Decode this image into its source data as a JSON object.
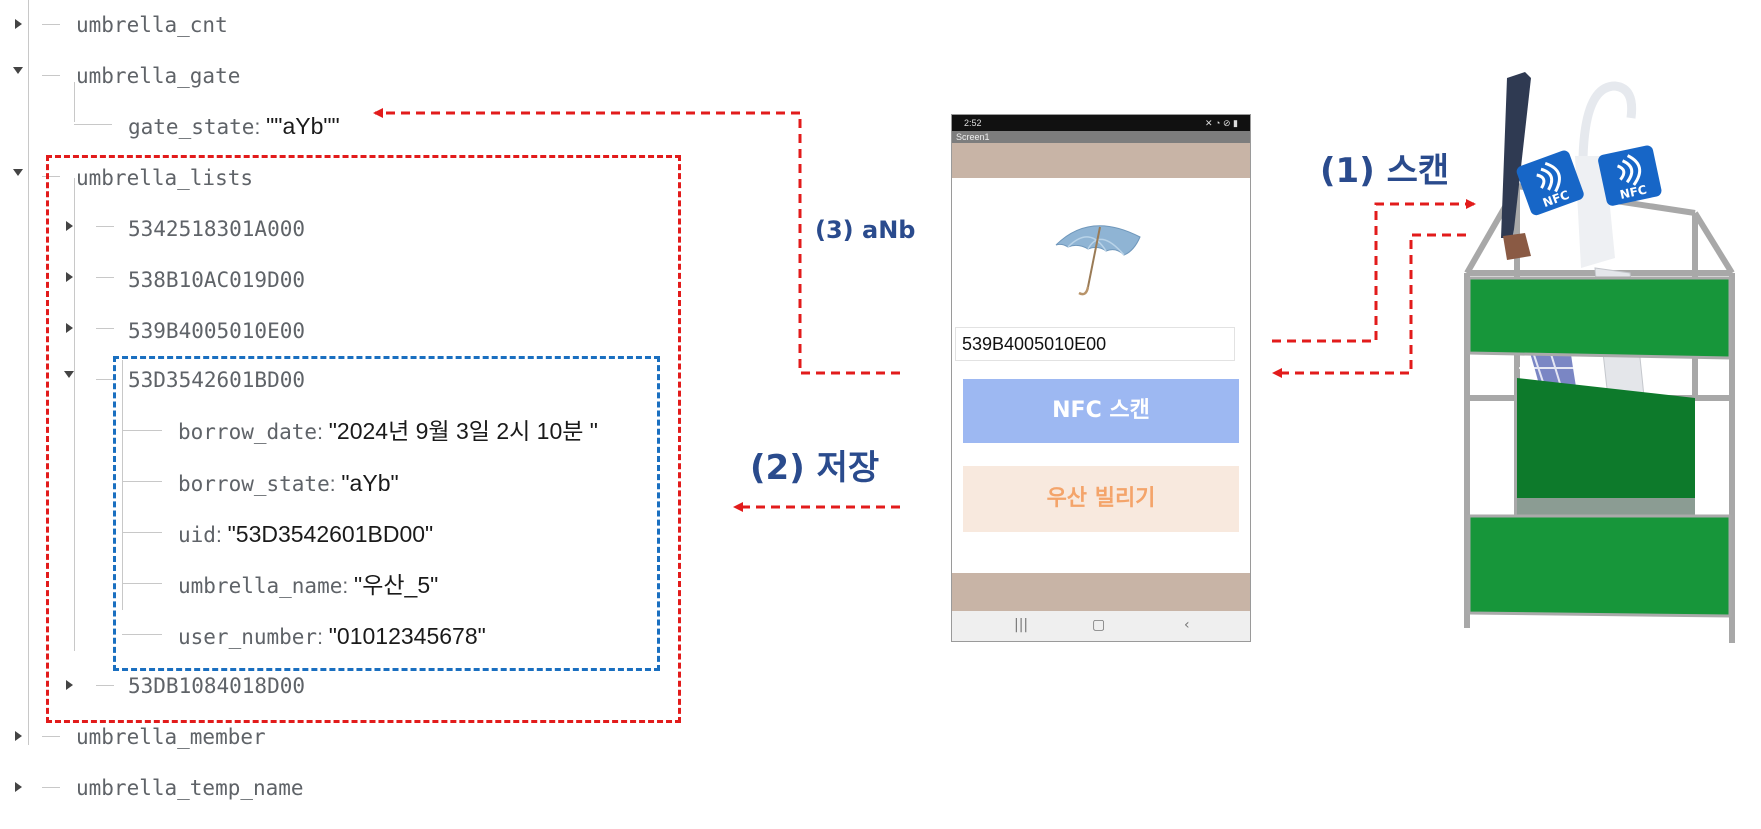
{
  "tree": {
    "umbrella_cnt": "umbrella_cnt",
    "umbrella_gate": "umbrella_gate",
    "gate_state_key": "gate_state",
    "gate_state_value": "\"\"aYb\"\"",
    "umbrella_lists": "umbrella_lists",
    "lists": [
      {
        "id": "5342518301A000"
      },
      {
        "id": "538B10AC019D00"
      },
      {
        "id": "539B4005010E00"
      },
      {
        "id": "53D3542601BD00"
      },
      {
        "id": "53DB1084018D00"
      }
    ],
    "expanded_fields": [
      {
        "key": "borrow_date",
        "value": "\"2024년 9월 3일 2시 10분 \""
      },
      {
        "key": "borrow_state",
        "value": "\"aYb\""
      },
      {
        "key": "uid",
        "value": "\"53D3542601BD00\""
      },
      {
        "key": "umbrella_name",
        "value": "\"우산_5\""
      },
      {
        "key": "user_number",
        "value": "\"01012345678\""
      }
    ],
    "umbrella_member": "umbrella_member",
    "umbrella_temp_name": "umbrella_temp_name"
  },
  "steps": {
    "scan": "(1) 스캔",
    "save": "(2) 저장",
    "anb": "(3) aNb"
  },
  "phone": {
    "status_time": "2:52",
    "screen_title": "Screen1",
    "uid_field": "539B4005010E00",
    "nfc_button": "NFC 스캔",
    "borrow_button": "우산 빌리기"
  },
  "nfc_tag_label": "NFC",
  "colors": {
    "red_dashed": "#e21b1b",
    "blue_dashed": "#1a6fc0",
    "step_text": "#2a4b8d",
    "nfc_button": "#9db8f2",
    "borrow_button_bg": "#f8e9de",
    "borrow_button_text": "#f4a46a",
    "phone_band": "#c8b4a6",
    "stand_green": "#17963a"
  }
}
